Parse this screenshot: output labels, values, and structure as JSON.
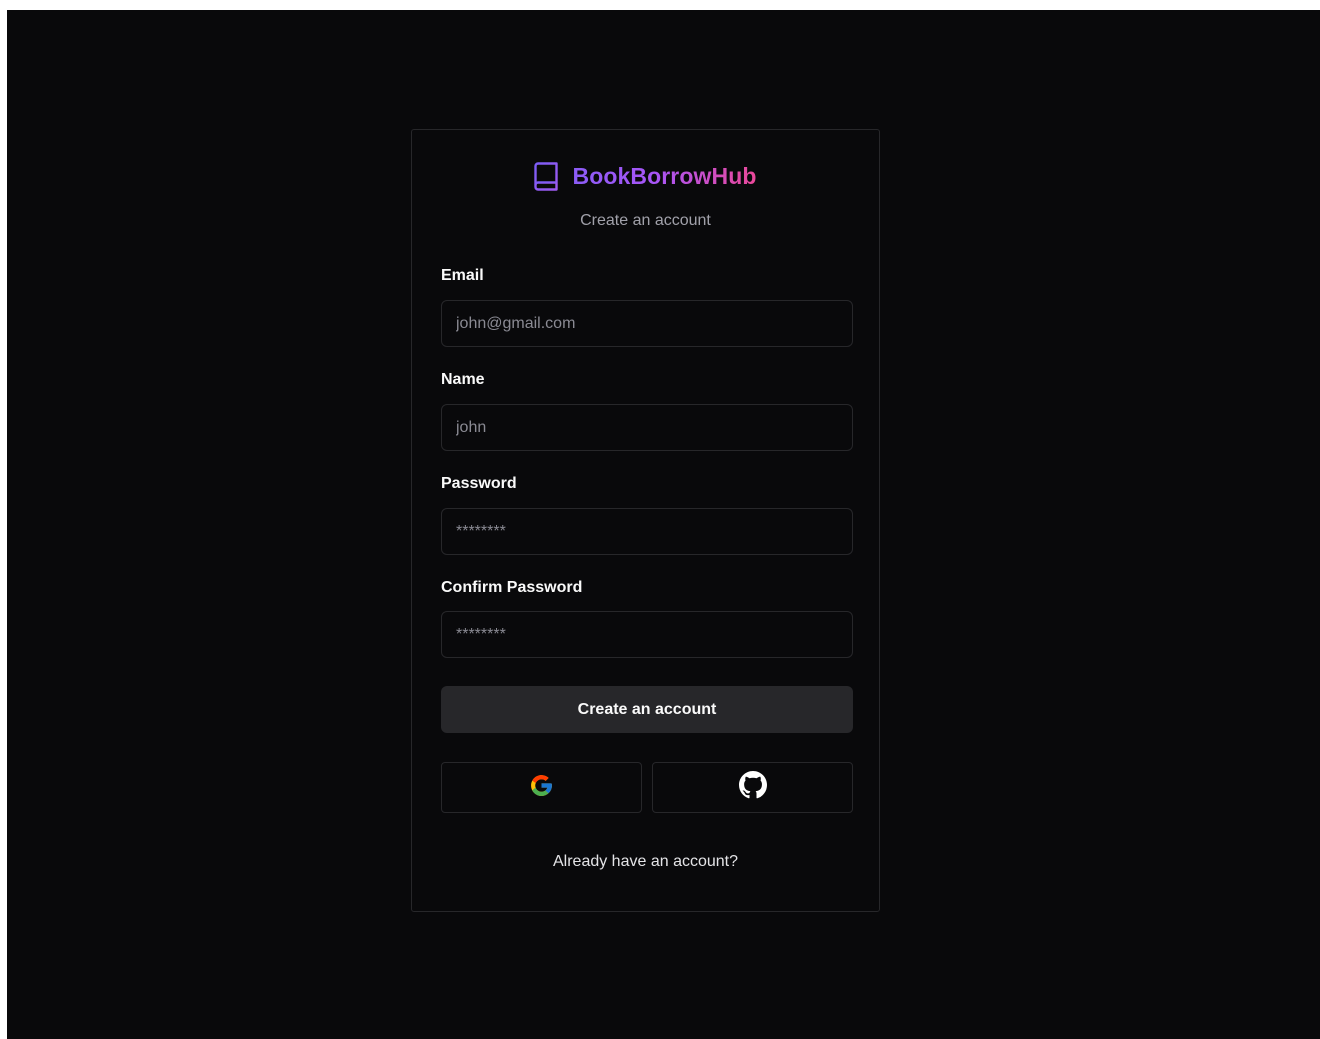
{
  "brand": {
    "name": "BookBorrowHub",
    "icon": "book-icon",
    "gradient": [
      "#8b5cf6",
      "#ec4899"
    ]
  },
  "subtitle": "Create an account",
  "fields": {
    "email": {
      "label": "Email",
      "placeholder": "john@gmail.com"
    },
    "name": {
      "label": "Name",
      "placeholder": "john"
    },
    "password": {
      "label": "Password",
      "placeholder": "********"
    },
    "confirm_password": {
      "label": "Confirm Password",
      "placeholder": "********"
    }
  },
  "submit_label": "Create an account",
  "oauth": [
    {
      "provider": "google",
      "icon": "google-icon"
    },
    {
      "provider": "github",
      "icon": "github-icon"
    }
  ],
  "login_link": "Already have an account?",
  "colors": {
    "background": "#09090b",
    "border": "#27272a",
    "button": "#27272a",
    "muted_text": "#a1a1aa"
  }
}
